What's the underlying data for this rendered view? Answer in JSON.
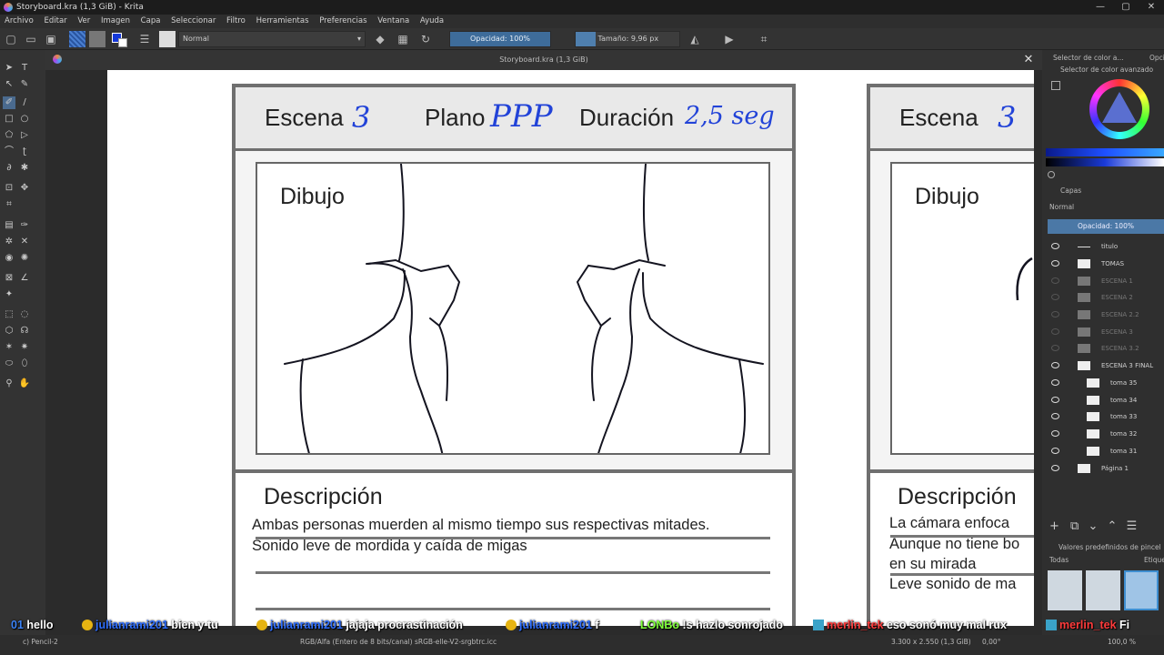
{
  "window": {
    "title": "Storyboard.kra (1,3 GiB) - Krita",
    "minimize": "—",
    "maximize": "▢",
    "close": "✕"
  },
  "menu": [
    "Archivo",
    "Editar",
    "Ver",
    "Imagen",
    "Capa",
    "Seleccionar",
    "Filtro",
    "Herramientas",
    "Preferencias",
    "Ventana",
    "Ayuda"
  ],
  "toolbar": {
    "blend_mode": "Normal",
    "opacity_label": "Opacidad: 100%",
    "size_label": "Tamaño: 9,96 px"
  },
  "document": {
    "tab_title": "Storyboard.kra (1,3 GiB)",
    "close": "✕"
  },
  "storyboard": {
    "panel1": {
      "scene_label": "Escena",
      "scene_value": "3",
      "shot_label": "Plano",
      "shot_value": "PPP",
      "duration_label": "Duración",
      "duration_value": "2,5 seg",
      "drawing_label": "Dibujo",
      "desc_title": "Descripción",
      "desc_lines": [
        "Ambas personas muerden al mismo tiempo sus respectivas mitades.",
        "Sonido leve de mordida y caída de migas"
      ]
    },
    "panel2": {
      "scene_label": "Escena",
      "scene_value": "3",
      "drawing_label": "Dibujo",
      "desc_title": "Descripción",
      "desc_lines": [
        "La cámara enfoca",
        "Aunque no tiene bo",
        "en su mirada",
        "Leve sonido de ma"
      ]
    }
  },
  "right_panel": {
    "tab1": "Selector de color a...",
    "tab2": "Opcione",
    "color_selector_title": "Selector de color avanzado",
    "layers_title": "Capas",
    "layers_blend": "Normal",
    "layers_opacity": "Opacidad: 100%",
    "layers": [
      {
        "name": "titulo",
        "visible": true
      },
      {
        "name": "TOMAS",
        "visible": true
      },
      {
        "name": "ESCENA 1",
        "visible": false
      },
      {
        "name": "ESCENA 2",
        "visible": false
      },
      {
        "name": "ESCENA 2.2",
        "visible": false
      },
      {
        "name": "ESCENA 3",
        "visible": false
      },
      {
        "name": "ESCENA 3.2",
        "visible": false
      },
      {
        "name": "ESCENA 3 FINAL",
        "visible": true
      },
      {
        "name": "toma 35",
        "visible": true
      },
      {
        "name": "toma 34",
        "visible": true
      },
      {
        "name": "toma 33",
        "visible": true
      },
      {
        "name": "toma 32",
        "visible": true
      },
      {
        "name": "toma 31",
        "visible": true
      },
      {
        "name": "Página 1",
        "visible": true
      }
    ],
    "brush_presets_title": "Valores predefinidos de pincel",
    "brush_filter": "Todas",
    "brush_tag": "Etique"
  },
  "chat": [
    {
      "user": "01",
      "user_color": "#3b82f6",
      "text": "hello"
    },
    {
      "user": "julianrami201",
      "user_color": "#2f6fff",
      "text": "bien y tu"
    },
    {
      "user": "julianrami201",
      "user_color": "#2f6fff",
      "text": "jajaja procrastinación"
    },
    {
      "user": "julianrami201",
      "user_color": "#2f6fff",
      "text": "f"
    },
    {
      "user": "LONBo",
      "user_color": "#7fff3a",
      "text": "!s hazlo sonrojado"
    },
    {
      "user": "merlin_tek",
      "user_color": "#ff3b3b",
      "text": "eso sonó muy mal rux"
    },
    {
      "user": "merlin_tek",
      "user_color": "#ff3b3b",
      "text": "Fi"
    }
  ],
  "status": {
    "brush": "c) Pencil-2",
    "color_space": "RGB/Alfa (Entero de 8 bits/canal)  sRGB-elle-V2-srgbtrc.icc",
    "dimensions": "3.300 x 2.550 (1,3 GiB)",
    "rotation": "0,00°",
    "zoom": "100,0 %"
  }
}
